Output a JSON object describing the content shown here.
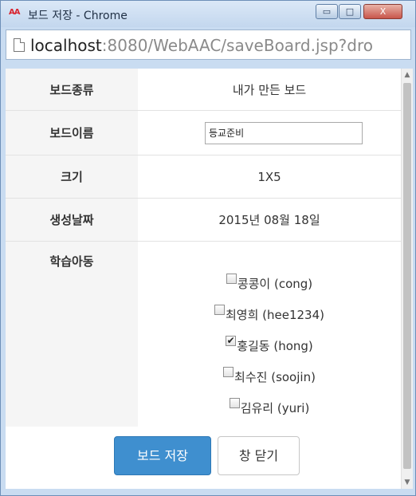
{
  "window": {
    "title": "보드 저장 - Chrome",
    "app_icon_text": "AA",
    "minimize_glyph": "▭",
    "maximize_glyph": "□",
    "close_glyph": "X"
  },
  "address": {
    "host": "localhost",
    "rest": ":8080/WebAAC/saveBoard.jsp?dro"
  },
  "form": {
    "board_type_label": "보드종류",
    "board_type_value": "내가 만든 보드",
    "board_name_label": "보드이름",
    "board_name_value": "등교준비",
    "size_label": "크기",
    "size_value": "1X5",
    "created_label": "생성날짜",
    "created_value": "2015년 08월 18일",
    "kids_label": "학습아동",
    "kids": [
      {
        "label": "콩콩이 (cong)",
        "checked": false
      },
      {
        "label": "최영희 (hee1234)",
        "checked": false
      },
      {
        "label": "홍길동 (hong)",
        "checked": true
      },
      {
        "label": "최수진 (soojin)",
        "checked": false
      },
      {
        "label": "김유리 (yuri)",
        "checked": false
      }
    ]
  },
  "actions": {
    "save_label": "보드 저장",
    "close_label": "창 닫기"
  },
  "scrollbar": {
    "up_glyph": "▲",
    "down_glyph": "▼"
  }
}
